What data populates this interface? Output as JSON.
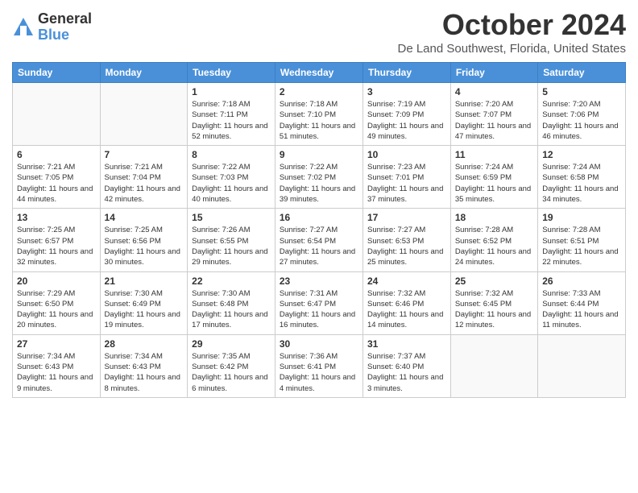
{
  "logo": {
    "general": "General",
    "blue": "Blue"
  },
  "title": "October 2024",
  "location": "De Land Southwest, Florida, United States",
  "days_of_week": [
    "Sunday",
    "Monday",
    "Tuesday",
    "Wednesday",
    "Thursday",
    "Friday",
    "Saturday"
  ],
  "weeks": [
    [
      {
        "day": "",
        "empty": true
      },
      {
        "day": "",
        "empty": true
      },
      {
        "day": "1",
        "sunrise": "7:18 AM",
        "sunset": "7:11 PM",
        "daylight": "11 hours and 52 minutes."
      },
      {
        "day": "2",
        "sunrise": "7:18 AM",
        "sunset": "7:10 PM",
        "daylight": "11 hours and 51 minutes."
      },
      {
        "day": "3",
        "sunrise": "7:19 AM",
        "sunset": "7:09 PM",
        "daylight": "11 hours and 49 minutes."
      },
      {
        "day": "4",
        "sunrise": "7:20 AM",
        "sunset": "7:07 PM",
        "daylight": "11 hours and 47 minutes."
      },
      {
        "day": "5",
        "sunrise": "7:20 AM",
        "sunset": "7:06 PM",
        "daylight": "11 hours and 46 minutes."
      }
    ],
    [
      {
        "day": "6",
        "sunrise": "7:21 AM",
        "sunset": "7:05 PM",
        "daylight": "11 hours and 44 minutes."
      },
      {
        "day": "7",
        "sunrise": "7:21 AM",
        "sunset": "7:04 PM",
        "daylight": "11 hours and 42 minutes."
      },
      {
        "day": "8",
        "sunrise": "7:22 AM",
        "sunset": "7:03 PM",
        "daylight": "11 hours and 40 minutes."
      },
      {
        "day": "9",
        "sunrise": "7:22 AM",
        "sunset": "7:02 PM",
        "daylight": "11 hours and 39 minutes."
      },
      {
        "day": "10",
        "sunrise": "7:23 AM",
        "sunset": "7:01 PM",
        "daylight": "11 hours and 37 minutes."
      },
      {
        "day": "11",
        "sunrise": "7:24 AM",
        "sunset": "6:59 PM",
        "daylight": "11 hours and 35 minutes."
      },
      {
        "day": "12",
        "sunrise": "7:24 AM",
        "sunset": "6:58 PM",
        "daylight": "11 hours and 34 minutes."
      }
    ],
    [
      {
        "day": "13",
        "sunrise": "7:25 AM",
        "sunset": "6:57 PM",
        "daylight": "11 hours and 32 minutes."
      },
      {
        "day": "14",
        "sunrise": "7:25 AM",
        "sunset": "6:56 PM",
        "daylight": "11 hours and 30 minutes."
      },
      {
        "day": "15",
        "sunrise": "7:26 AM",
        "sunset": "6:55 PM",
        "daylight": "11 hours and 29 minutes."
      },
      {
        "day": "16",
        "sunrise": "7:27 AM",
        "sunset": "6:54 PM",
        "daylight": "11 hours and 27 minutes."
      },
      {
        "day": "17",
        "sunrise": "7:27 AM",
        "sunset": "6:53 PM",
        "daylight": "11 hours and 25 minutes."
      },
      {
        "day": "18",
        "sunrise": "7:28 AM",
        "sunset": "6:52 PM",
        "daylight": "11 hours and 24 minutes."
      },
      {
        "day": "19",
        "sunrise": "7:28 AM",
        "sunset": "6:51 PM",
        "daylight": "11 hours and 22 minutes."
      }
    ],
    [
      {
        "day": "20",
        "sunrise": "7:29 AM",
        "sunset": "6:50 PM",
        "daylight": "11 hours and 20 minutes."
      },
      {
        "day": "21",
        "sunrise": "7:30 AM",
        "sunset": "6:49 PM",
        "daylight": "11 hours and 19 minutes."
      },
      {
        "day": "22",
        "sunrise": "7:30 AM",
        "sunset": "6:48 PM",
        "daylight": "11 hours and 17 minutes."
      },
      {
        "day": "23",
        "sunrise": "7:31 AM",
        "sunset": "6:47 PM",
        "daylight": "11 hours and 16 minutes."
      },
      {
        "day": "24",
        "sunrise": "7:32 AM",
        "sunset": "6:46 PM",
        "daylight": "11 hours and 14 minutes."
      },
      {
        "day": "25",
        "sunrise": "7:32 AM",
        "sunset": "6:45 PM",
        "daylight": "11 hours and 12 minutes."
      },
      {
        "day": "26",
        "sunrise": "7:33 AM",
        "sunset": "6:44 PM",
        "daylight": "11 hours and 11 minutes."
      }
    ],
    [
      {
        "day": "27",
        "sunrise": "7:34 AM",
        "sunset": "6:43 PM",
        "daylight": "11 hours and 9 minutes."
      },
      {
        "day": "28",
        "sunrise": "7:34 AM",
        "sunset": "6:43 PM",
        "daylight": "11 hours and 8 minutes."
      },
      {
        "day": "29",
        "sunrise": "7:35 AM",
        "sunset": "6:42 PM",
        "daylight": "11 hours and 6 minutes."
      },
      {
        "day": "30",
        "sunrise": "7:36 AM",
        "sunset": "6:41 PM",
        "daylight": "11 hours and 4 minutes."
      },
      {
        "day": "31",
        "sunrise": "7:37 AM",
        "sunset": "6:40 PM",
        "daylight": "11 hours and 3 minutes."
      },
      {
        "day": "",
        "empty": true
      },
      {
        "day": "",
        "empty": true
      }
    ]
  ]
}
